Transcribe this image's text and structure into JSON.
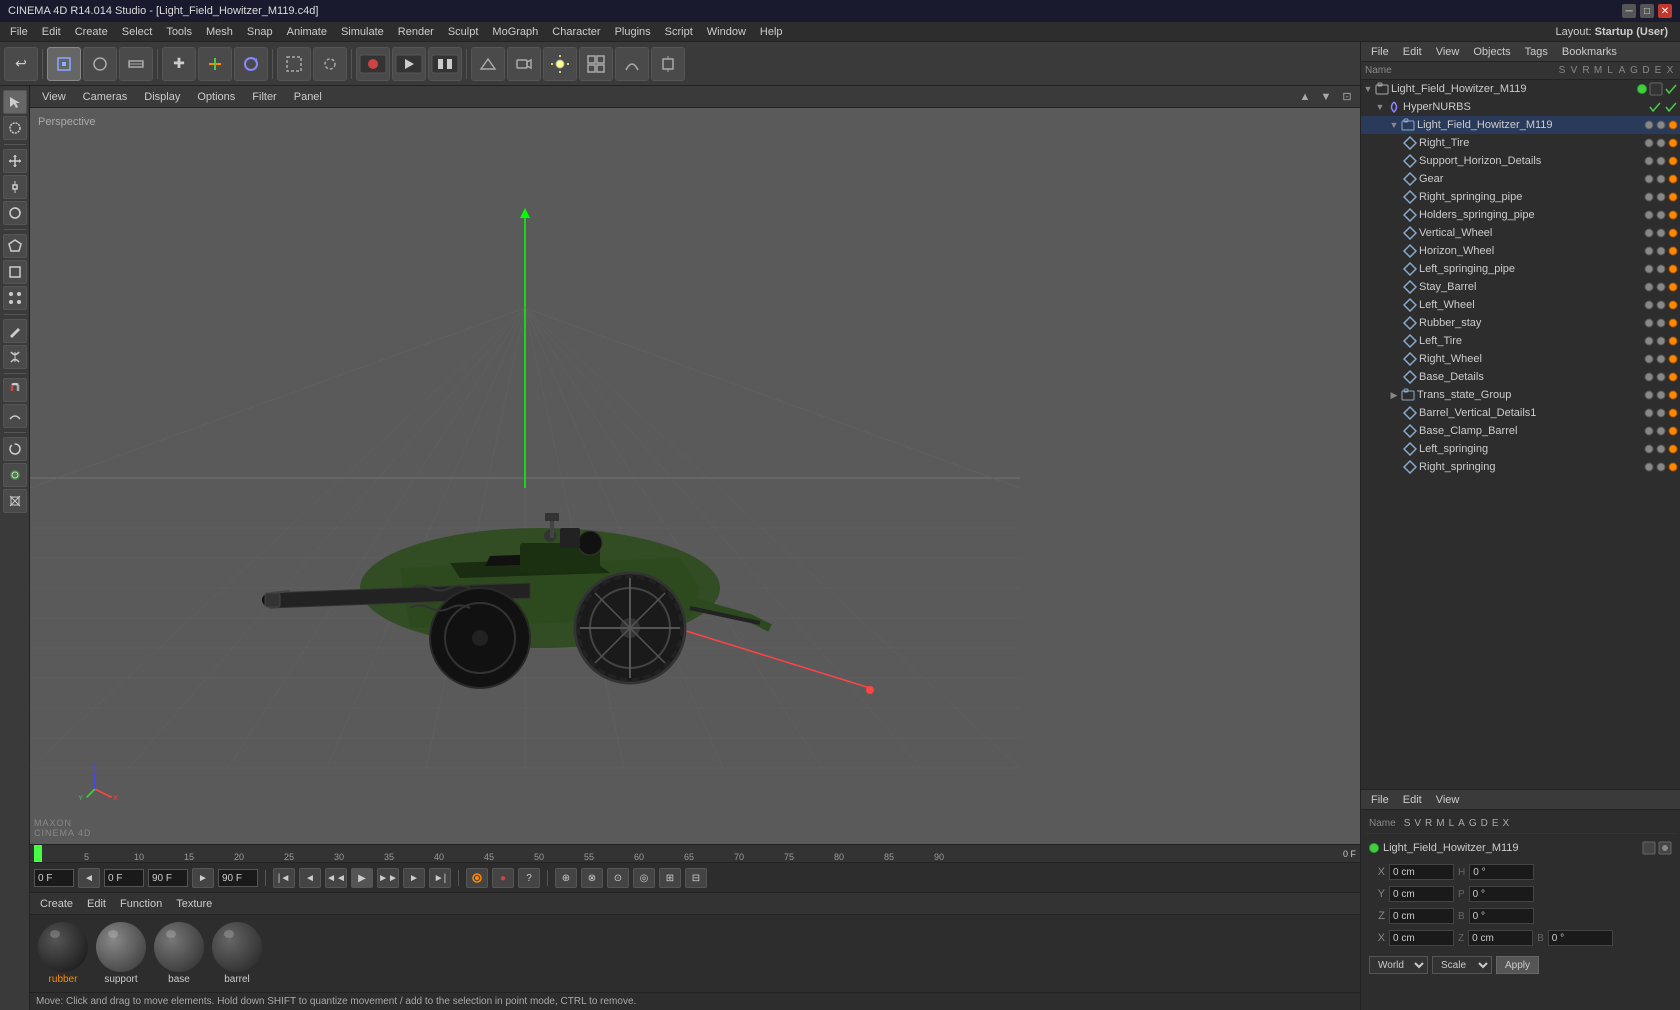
{
  "window": {
    "title": "CINEMA 4D R14.014 Studio - [Light_Field_Howitzer_M119.c4d]"
  },
  "menu": {
    "items": [
      "File",
      "Edit",
      "Create",
      "Select",
      "Tools",
      "Mesh",
      "Snap",
      "Animate",
      "Simulate",
      "Render",
      "Sculpt",
      "MoGraph",
      "Character",
      "Plugins",
      "Script",
      "Window",
      "Help"
    ],
    "layout_label": "Layout:",
    "layout_value": "Startup (User)"
  },
  "viewport": {
    "perspective_label": "Perspective",
    "menu_items": [
      "View",
      "Cameras",
      "Display",
      "Options",
      "Filter",
      "Panel"
    ]
  },
  "object_manager": {
    "menu_items": [
      "File",
      "Edit",
      "View",
      "Objects",
      "Tags",
      "Bookmarks"
    ],
    "root_name": "Light_Field_Howitzer_M119",
    "objects": [
      {
        "id": "root",
        "name": "Light_Field_Howitzer_M119",
        "indent": 0,
        "type": "group",
        "has_expand": true,
        "expanded": true
      },
      {
        "id": "hypernurbs",
        "name": "HyperNURBS",
        "indent": 1,
        "type": "nurbs",
        "has_expand": true,
        "expanded": true
      },
      {
        "id": "main",
        "name": "Light_Field_Howitzer_M119",
        "indent": 2,
        "type": "group",
        "has_expand": true,
        "expanded": true
      },
      {
        "id": "right_tire",
        "name": "Right_Tire",
        "indent": 3,
        "type": "poly"
      },
      {
        "id": "support_horizon",
        "name": "Support_Horizon_Details",
        "indent": 3,
        "type": "poly"
      },
      {
        "id": "gear",
        "name": "Gear",
        "indent": 3,
        "type": "poly"
      },
      {
        "id": "right_spring_pipe",
        "name": "Right_springing_pipe",
        "indent": 3,
        "type": "poly"
      },
      {
        "id": "holders_spring_pipe",
        "name": "Holders_springing_pipe",
        "indent": 3,
        "type": "poly"
      },
      {
        "id": "vertical_wheel",
        "name": "Vertical_Wheel",
        "indent": 3,
        "type": "poly"
      },
      {
        "id": "horizon_wheel",
        "name": "Horizon_Wheel",
        "indent": 3,
        "type": "poly"
      },
      {
        "id": "left_spring_pipe",
        "name": "Left_springing_pipe",
        "indent": 3,
        "type": "poly"
      },
      {
        "id": "stay_barrel",
        "name": "Stay_Barrel",
        "indent": 3,
        "type": "poly"
      },
      {
        "id": "left_wheel",
        "name": "Left_Wheel",
        "indent": 3,
        "type": "poly"
      },
      {
        "id": "rubber_stay",
        "name": "Rubber_stay",
        "indent": 3,
        "type": "poly"
      },
      {
        "id": "left_tire",
        "name": "Left_Tire",
        "indent": 3,
        "type": "poly"
      },
      {
        "id": "right_wheel",
        "name": "Right_Wheel",
        "indent": 3,
        "type": "poly"
      },
      {
        "id": "base_details",
        "name": "Base_Details",
        "indent": 3,
        "type": "poly"
      },
      {
        "id": "trans_state_group",
        "name": "Trans_state_Group",
        "indent": 2,
        "type": "group",
        "has_expand": true,
        "expanded": false
      },
      {
        "id": "barrel_vertical",
        "name": "Barrel_Vertical_Details1",
        "indent": 3,
        "type": "poly"
      },
      {
        "id": "base_clamp",
        "name": "Base_Clamp_Barrel",
        "indent": 3,
        "type": "poly"
      },
      {
        "id": "left_springing",
        "name": "Left_springing",
        "indent": 3,
        "type": "poly"
      },
      {
        "id": "right_springing",
        "name": "Right_springing",
        "indent": 3,
        "type": "poly"
      }
    ]
  },
  "attributes": {
    "menu_items": [
      "File",
      "Edit",
      "View"
    ],
    "columns": {
      "name_label": "Name",
      "s": "S",
      "v": "V",
      "r": "R",
      "m": "M",
      "l": "L",
      "a": "A",
      "g": "G",
      "d": "D",
      "e": "E",
      "x": "X"
    },
    "selected_name": "Light_Field_Howitzer_M119",
    "coords": {
      "x_pos": "0 cm",
      "y_pos": "0 cm",
      "z_pos": "0 cm",
      "x_rot": "0 °",
      "y_rot": "0 °",
      "z_rot": "0 °",
      "x_scl": "0 cm",
      "y_scl": "0 cm",
      "z_scl": "0 cm",
      "h_val": "0 °",
      "p_val": "0 °",
      "b_val": "0 °"
    },
    "world_label": "World",
    "scale_label": "Scale",
    "apply_label": "Apply"
  },
  "timeline": {
    "frame_start": "0 F",
    "frame_current": "0 F",
    "frame_end": "90 F",
    "frame_end2": "90 F",
    "markers": [
      "0",
      "5",
      "10",
      "15",
      "20",
      "25",
      "30",
      "35",
      "40",
      "45",
      "50",
      "55",
      "60",
      "65",
      "70",
      "75",
      "80",
      "85",
      "90"
    ]
  },
  "materials": {
    "menu_items": [
      "Create",
      "Edit",
      "Function",
      "Texture"
    ],
    "items": [
      {
        "id": "rubber",
        "name": "rubber",
        "type": "rubber",
        "active": true
      },
      {
        "id": "support",
        "name": "support",
        "type": "support",
        "active": false
      },
      {
        "id": "base",
        "name": "base",
        "type": "base",
        "active": false
      },
      {
        "id": "barrel",
        "name": "barrel",
        "type": "barrel",
        "active": false
      }
    ]
  },
  "status_bar": {
    "message": "Move: Click and drag to move elements. Hold down SHIFT to quantize movement / add to the selection in point mode, CTRL to remove."
  },
  "toolbar": {
    "tools": [
      "↩",
      "⬚",
      "↺",
      "+",
      "✕",
      "●",
      "⊕",
      "⌚",
      "▶",
      "■",
      "⬛",
      "⬤",
      "☰",
      "⚙"
    ]
  }
}
